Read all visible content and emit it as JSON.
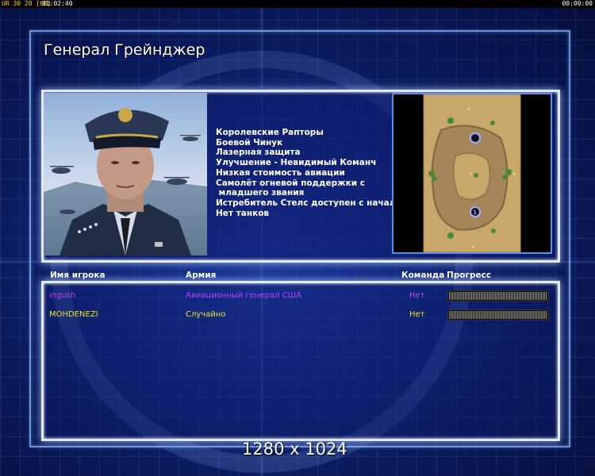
{
  "hud": {
    "fps_text": "UR 30 20 [60]",
    "clock_left": "01:02:40",
    "clock_right": "00:00:00"
  },
  "general": {
    "name": "Генерал Грейнджер",
    "specials": [
      "Королевские Рапторы",
      "Боевой Чинук",
      "Лазерная защита",
      "Улучшение - Невидимый Команч",
      "Низкая стоимость авиации",
      "Самолёт огневой поддержки с",
      " младшего звания",
      "Истребитель Стелс доступен с начала",
      "Нет танков"
    ]
  },
  "players_table": {
    "headers": {
      "name": "Имя игрока",
      "army": "Армия",
      "team": "Команда",
      "progress": "Прогресс"
    },
    "rows": [
      {
        "name": "ingush",
        "army": "Авиационный генерал США",
        "team": "Нет",
        "progress": 0,
        "color": "#c040ff"
      },
      {
        "name": "MOHDENEZI",
        "army": "Случайно",
        "team": "Нет",
        "progress": 0,
        "color": "#f0e020"
      }
    ]
  },
  "resolution_label": "1280 x 1024",
  "colors": {
    "frame_glow": "#dfe9ff",
    "background": "#142d86",
    "map_sand": "#c9a66a"
  },
  "icons": {
    "map": "minimap-icon",
    "portrait": "general-portrait-icon"
  }
}
